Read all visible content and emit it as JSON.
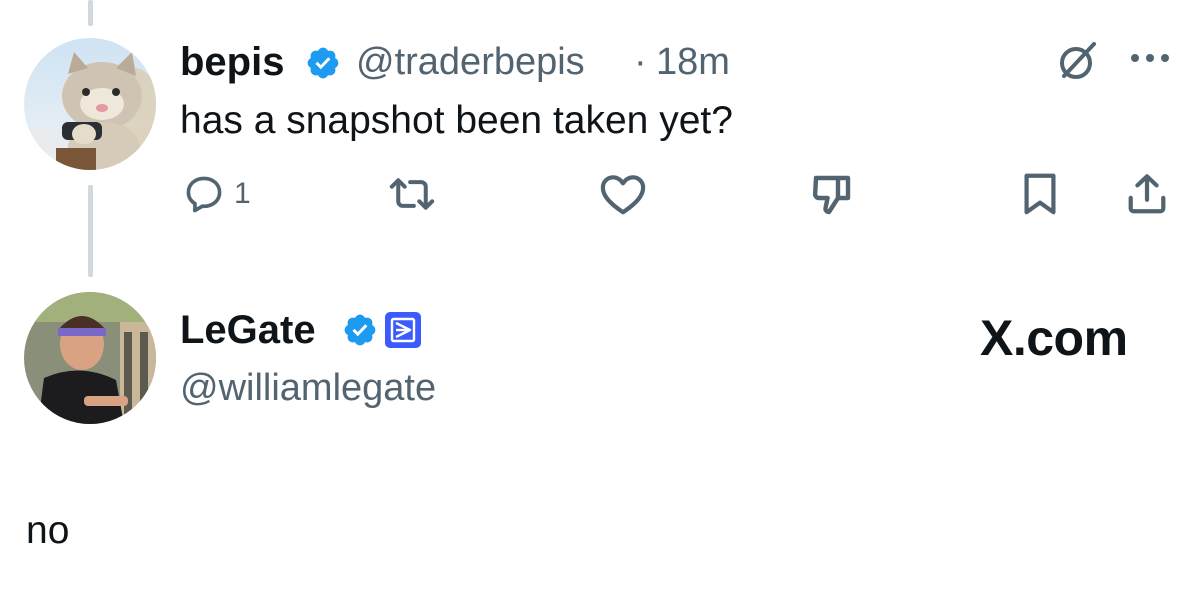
{
  "parent_post": {
    "author_name": "bepis",
    "handle": "@traderbepis",
    "separator": "·",
    "time": "18m",
    "text": "has a snapshot been taken yet?",
    "reply_count": "1",
    "verified_color": "#1d9bf0"
  },
  "quote_post": {
    "author_name": "LeGate",
    "handle": "@williamlegate",
    "brand_text": "X.com",
    "text": "no",
    "affiliate_badge_color": "#3b5bfd"
  },
  "icons": {
    "grok": "grok-icon",
    "more": "more-icon",
    "reply": "reply-icon",
    "repost": "repost-icon",
    "like": "like-icon",
    "dislike": "dislike-icon",
    "bookmark": "bookmark-icon",
    "share": "share-icon"
  },
  "colors": {
    "text_primary": "#0f1419",
    "text_secondary": "#536471",
    "thread_line": "#cfd9de",
    "verified": "#1d9bf0"
  }
}
